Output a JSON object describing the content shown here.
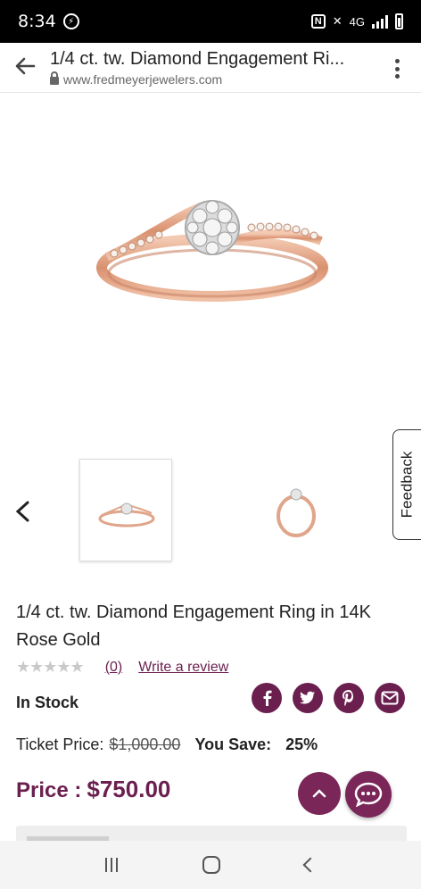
{
  "status": {
    "time": "8:34",
    "network": "4G"
  },
  "browser": {
    "title": "1/4 ct. tw. Diamond Engagement Ri...",
    "url": "www.fredmeyerjewelers.com"
  },
  "feedback_label": "Feedback",
  "product": {
    "title": "1/4 ct. tw. Diamond Engagement Ring in 14K Rose Gold",
    "stars": "★★★★★",
    "review_count": "(0)",
    "write_review": "Write a review",
    "stock": "In Stock",
    "ticket_label": "Ticket Price:",
    "ticket_price": "$1,000.00",
    "save_label": "You Save:",
    "save_value": "25%",
    "price_label": "Price :",
    "price_value": "$750.00"
  },
  "share": [
    "facebook-icon",
    "twitter-icon",
    "pinterest-icon",
    "email-icon"
  ],
  "colors": {
    "brand": "#6b1f4f",
    "rose_gold": "#e0a58a"
  }
}
